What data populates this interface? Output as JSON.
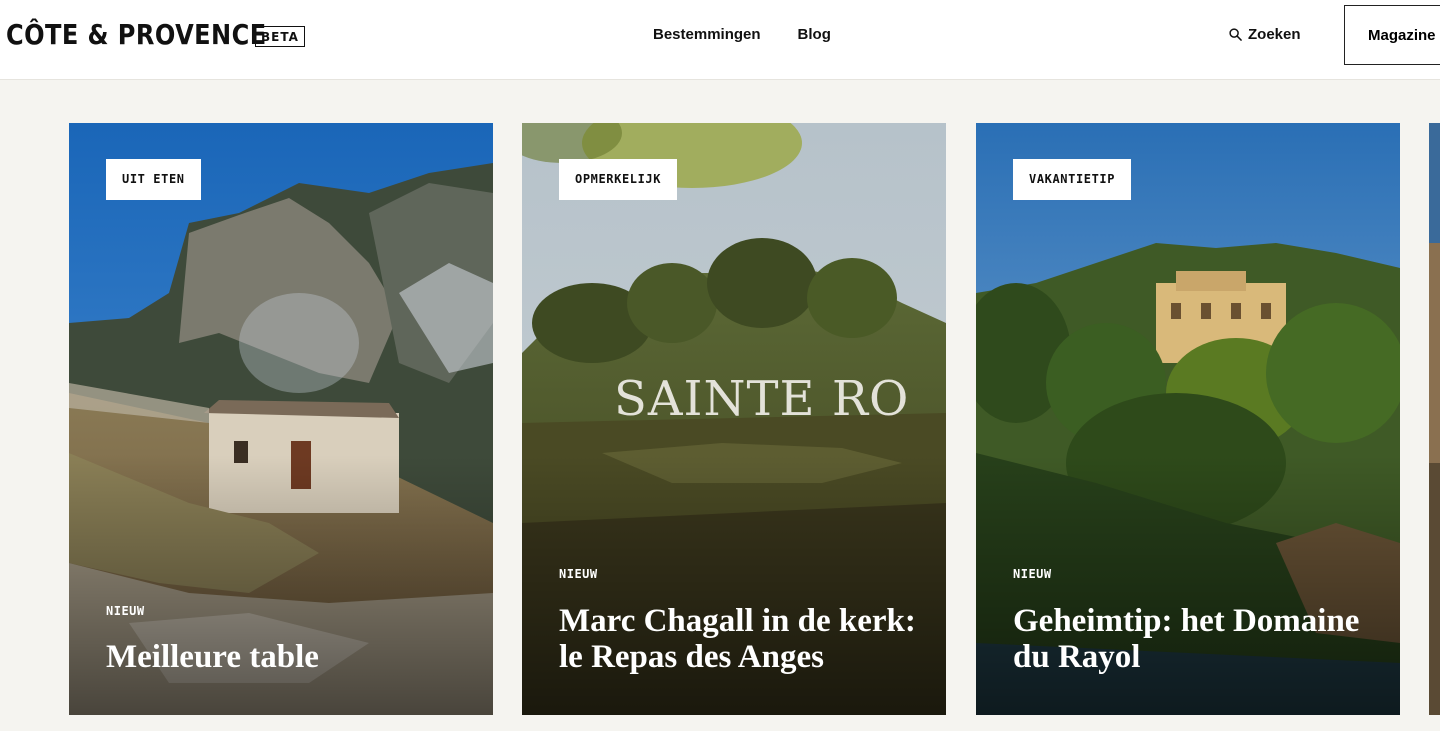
{
  "header": {
    "logo": "CÔTE & PROVENCE",
    "badge": "BETA",
    "nav": [
      "Bestemmingen",
      "Blog"
    ],
    "search_label": "Zoeken",
    "magazine_label": "Magazine"
  },
  "cards": [
    {
      "tag": "UIT ETEN",
      "label": "NIEUW",
      "title": "Meilleure table"
    },
    {
      "tag": "OPMERKELIJK",
      "label": "NIEUW",
      "title": "Marc Chagall in de kerk: le Repas des Anges",
      "sign_text": "SAINTE RO"
    },
    {
      "tag": "VAKANTIETIP",
      "label": "NIEUW",
      "title": "Geheimtip: het Domaine du Rayol"
    }
  ],
  "colors": {
    "background": "#f5f4f0",
    "header": "#ffffff",
    "text": "#111111"
  }
}
